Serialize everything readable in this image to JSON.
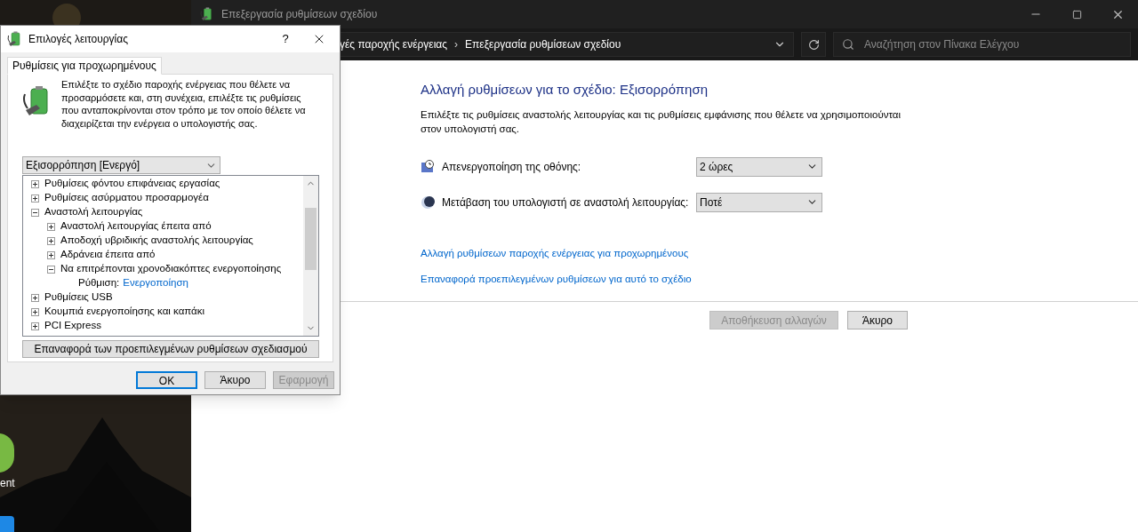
{
  "desktop": {
    "icons": [
      {
        "label": "ent"
      }
    ]
  },
  "main_window": {
    "title": "Επεξεργασία ρυθμίσεων σχεδίου",
    "breadcrumb": [
      "γές παροχής ενέργειας",
      "Επεξεργασία ρυθμίσεων σχεδίου"
    ],
    "breadcrumb_separator": "›",
    "search": {
      "placeholder": "Αναζήτηση στον Πίνακα Ελέγχου"
    },
    "heading": "Αλλαγή ρυθμίσεων για το σχέδιο: Εξισορρόπηση",
    "description": "Επιλέξτε τις ρυθμίσεις αναστολής λειτουργίας και τις ρυθμίσεις εμφάνισης που θέλετε να χρησιμοποιούνται στον υπολογιστή σας.",
    "settings": [
      {
        "kind": "display",
        "label": "Απενεργοποίηση της οθόνης:",
        "value": "2 ώρες"
      },
      {
        "kind": "sleep",
        "label": "Μετάβαση του υπολογιστή σε αναστολή λειτουργίας:",
        "value": "Ποτέ"
      }
    ],
    "links": [
      "Αλλαγή ρυθμίσεων παροχής ενέργειας για προχωρημένους",
      "Επαναφορά προεπιλεγμένων ρυθμίσεων για αυτό το σχέδιο"
    ],
    "buttons": [
      {
        "label": "Αποθήκευση αλλαγών",
        "disabled": true
      },
      {
        "label": "Άκυρο",
        "disabled": false
      }
    ]
  },
  "dialog": {
    "title": "Επιλογές λειτουργίας",
    "help": "?",
    "tabs": [
      {
        "label": "Ρυθμίσεις για προχωρημένους",
        "selected": true
      }
    ],
    "description": "Επιλέξτε το σχέδιο παροχής ενέργειας που θέλετε να προσαρμόσετε και, στη συνέχεια, επιλέξτε τις ρυθμίσεις που ανταποκρίνονται στον τρόπο με τον οποίο θέλετε να διαχειρίζεται την ενέργεια ο υπολογιστής σας.",
    "plan": "Εξισορρόπηση [Ενεργό]",
    "tree": [
      {
        "kind": "node",
        "label": "Ρυθμίσεις φόντου επιφάνειας εργασίας",
        "expanded": false
      },
      {
        "kind": "node",
        "label": "Ρυθμίσεις ασύρματου προσαρμογέα",
        "expanded": false
      },
      {
        "kind": "node",
        "label": "Αναστολή λειτουργίας",
        "expanded": true,
        "children": [
          {
            "kind": "node",
            "label": "Αναστολή λειτουργίας έπειτα από",
            "expanded": false
          },
          {
            "kind": "node",
            "label": "Αποδοχή υβριδικής αναστολής λειτουργίας",
            "expanded": false
          },
          {
            "kind": "node",
            "label": "Αδράνεια έπειτα από",
            "expanded": false
          },
          {
            "kind": "node",
            "label": "Να επιτρέπονται χρονοδιακόπτες ενεργοποίησης",
            "expanded": true,
            "children": [
              {
                "kind": "setting",
                "label": "Ρύθμιση:",
                "value": "Ενεργοποίηση"
              }
            ]
          }
        ]
      },
      {
        "kind": "node",
        "label": "Ρυθμίσεις USB",
        "expanded": false
      },
      {
        "kind": "node",
        "label": "Κουμπιά ενεργοποίησης και καπάκι",
        "expanded": false
      },
      {
        "kind": "node",
        "label": "PCI Express",
        "expanded": false
      }
    ],
    "reset_button": "Επαναφορά των προεπιλεγμένων ρυθμίσεων σχεδιασμού",
    "buttons": [
      {
        "label": "OK",
        "default": true,
        "disabled": false
      },
      {
        "label": "Άκυρο",
        "default": false,
        "disabled": false
      },
      {
        "label": "Εφαρμογή",
        "default": false,
        "disabled": true
      }
    ]
  }
}
